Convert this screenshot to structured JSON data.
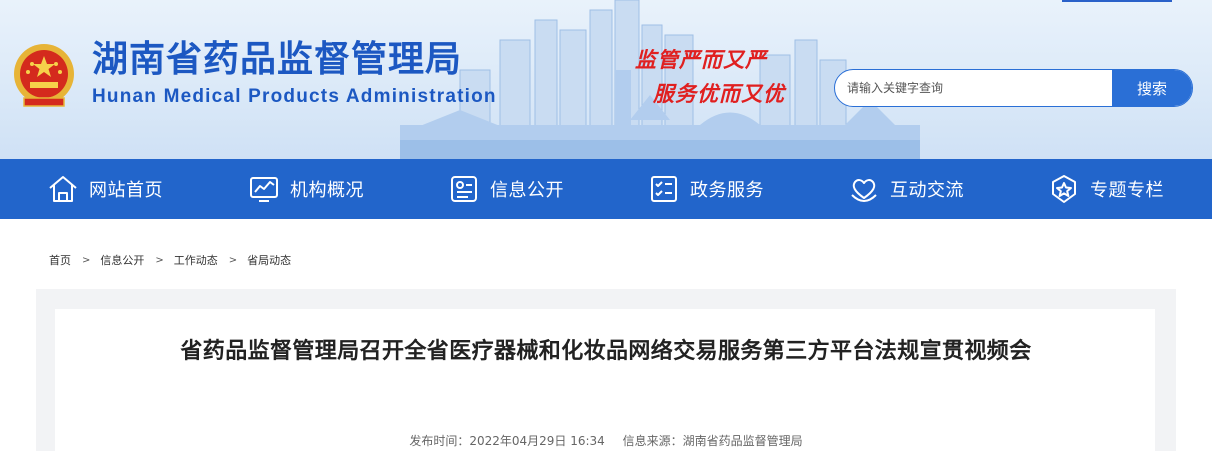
{
  "site": {
    "title_cn": "湖南省药品监督管理局",
    "title_en": "Hunan Medical Products Administration",
    "slogan_line1": "监管严而又严",
    "slogan_line2": "服务优而又优"
  },
  "search": {
    "placeholder": "请输入关键字查询",
    "button_label": "搜索"
  },
  "nav": {
    "items": [
      {
        "label": "网站首页",
        "icon": "home-icon"
      },
      {
        "label": "机构概况",
        "icon": "monitor-chart-icon"
      },
      {
        "label": "信息公开",
        "icon": "info-card-icon"
      },
      {
        "label": "政务服务",
        "icon": "checklist-icon"
      },
      {
        "label": "互动交流",
        "icon": "heart-hands-icon"
      },
      {
        "label": "专题专栏",
        "icon": "star-badge-icon"
      }
    ]
  },
  "breadcrumb": {
    "items": [
      "首页",
      "信息公开",
      "工作动态",
      "省局动态"
    ],
    "separator": ">"
  },
  "article": {
    "title": "省药品监督管理局召开全省医疗器械和化妆品网络交易服务第三方平台法规宣贯视频会",
    "publish_time": "发布时间：2022年04月29日 16:34",
    "source": "信息来源：湖南省药品监督管理局"
  },
  "colors": {
    "brand_blue": "#2265cb",
    "title_blue": "#1c58c2",
    "slogan_red": "#e02020"
  }
}
